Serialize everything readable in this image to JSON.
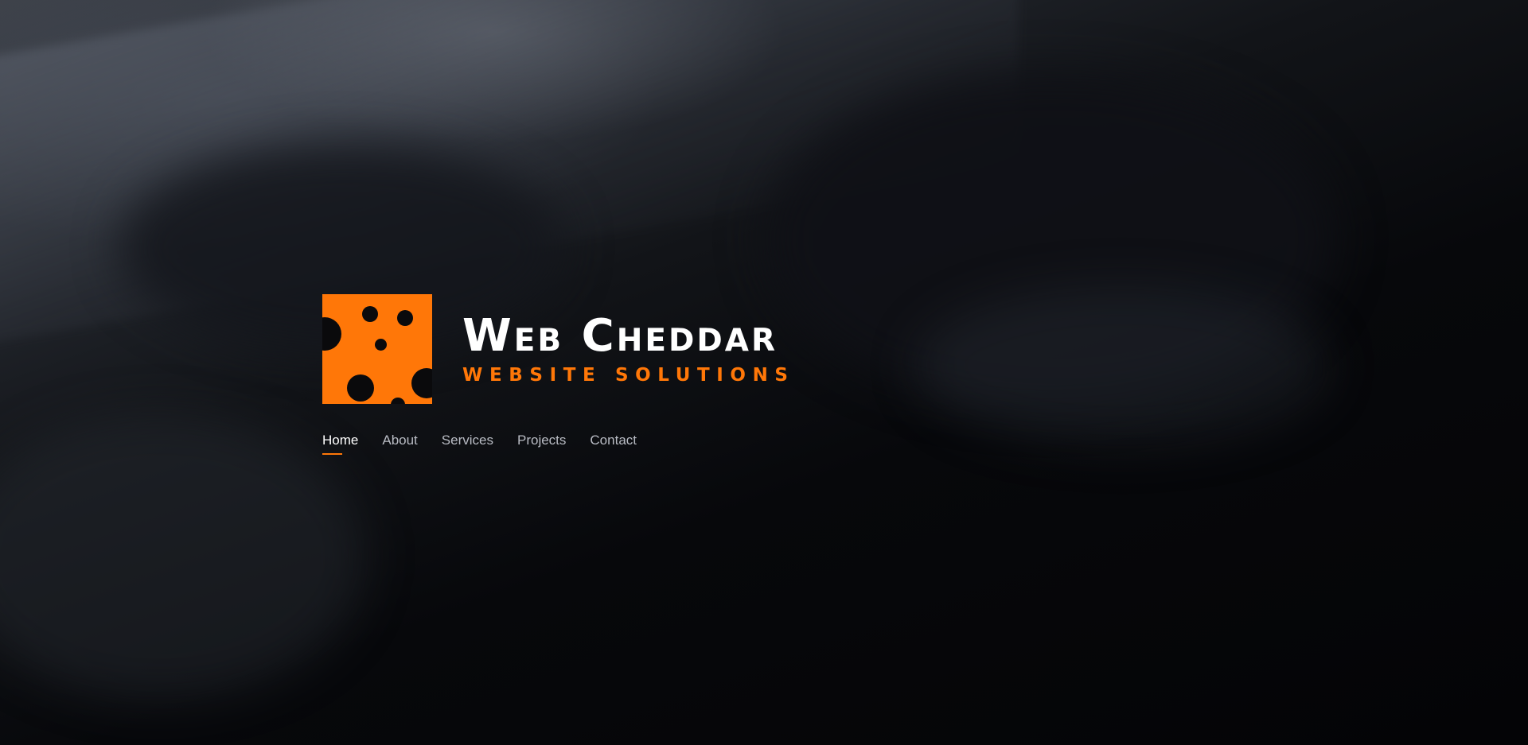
{
  "brand": {
    "name": "Web Cheddar",
    "tagline": "WEBSITE SOLUTIONS",
    "accent_color": "#ff7708",
    "logo_icon": "cheese-icon"
  },
  "nav": {
    "items": [
      {
        "label": "Home",
        "active": true
      },
      {
        "label": "About",
        "active": false
      },
      {
        "label": "Services",
        "active": false
      },
      {
        "label": "Projects",
        "active": false
      },
      {
        "label": "Contact",
        "active": false
      }
    ]
  }
}
